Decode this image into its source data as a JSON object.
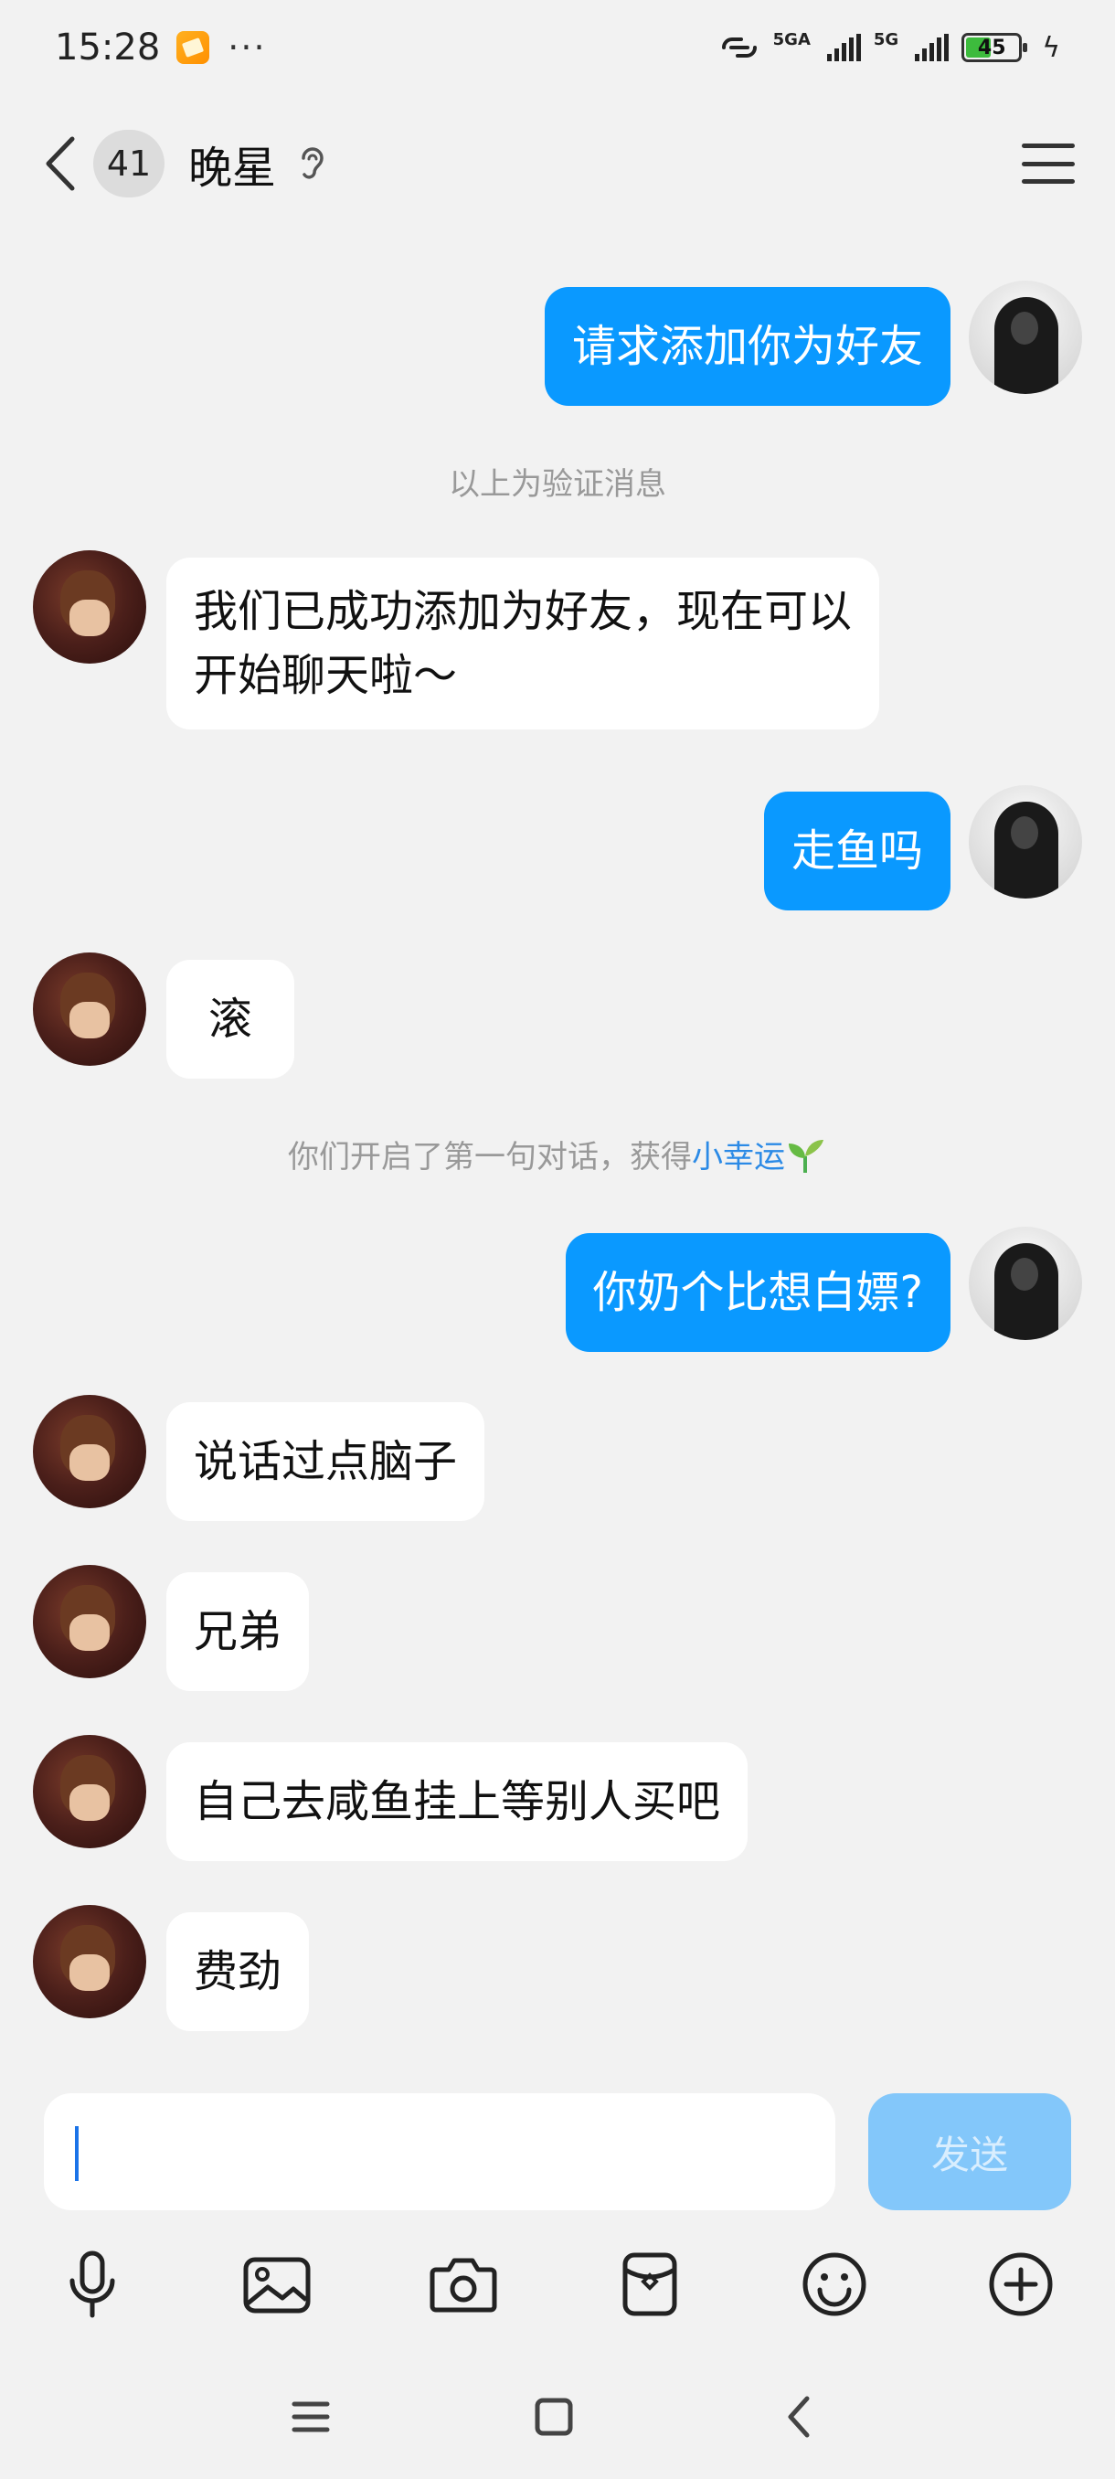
{
  "status_bar": {
    "time": "15:28",
    "more": "···",
    "signal1_label": "5GA",
    "signal2_label": "5G",
    "battery": "45",
    "icons": [
      "notification-app-icon",
      "link-icon",
      "signal-icon",
      "battery-icon",
      "charging-icon"
    ]
  },
  "header": {
    "unread_count": "41",
    "title": "晚星",
    "icons": [
      "back-icon",
      "ear-icon",
      "menu-icon"
    ]
  },
  "messages": [
    {
      "from": "self",
      "text": "请求添加你为好友"
    },
    {
      "type": "system",
      "text": "以上为验证消息"
    },
    {
      "from": "other",
      "text_line1": "我们已成功添加为好友，现在可以",
      "text_line2": "开始聊天啦～"
    },
    {
      "from": "self",
      "text": "走鱼吗"
    },
    {
      "from": "other",
      "text": "滚"
    },
    {
      "type": "system",
      "text": "你们开启了第一句对话，获得",
      "link": "小幸运"
    },
    {
      "from": "self",
      "text": "你奶个比想白嫖?"
    },
    {
      "from": "other",
      "text": "说话过点脑子"
    },
    {
      "from": "other",
      "text": "兄弟"
    },
    {
      "from": "other",
      "text": "自己去咸鱼挂上等别人买吧"
    },
    {
      "from": "other",
      "text": "费劲"
    }
  ],
  "input": {
    "value": "",
    "send_label": "发送"
  },
  "toolbar": {
    "icons": [
      "microphone-icon",
      "image-icon",
      "camera-icon",
      "red-packet-icon",
      "emoji-icon",
      "plus-icon"
    ]
  },
  "nav": {
    "icons": [
      "menu-nav-icon",
      "home-nav-icon",
      "back-nav-icon"
    ]
  },
  "colors": {
    "self_bubble": "#0a99ff",
    "other_bubble": "#ffffff",
    "background": "#f2f2f2",
    "send_button": "#83c7fa",
    "link": "#2b8ae6"
  }
}
